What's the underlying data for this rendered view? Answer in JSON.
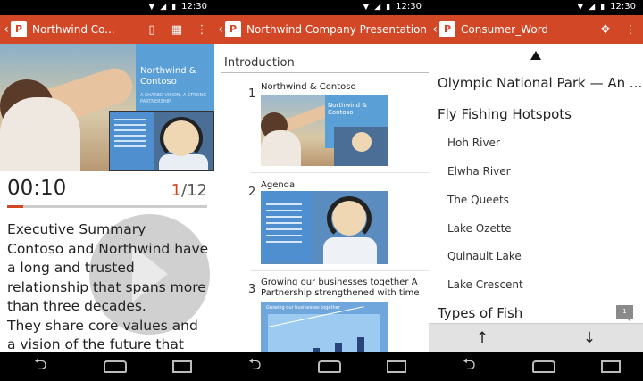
{
  "status": {
    "time": "12:30",
    "wifi_icon": "wifi-icon",
    "signal_icon": "signal-icon",
    "battery_icon": "battery-icon"
  },
  "colors": {
    "accent": "#d24726",
    "navbar": "#000000",
    "toolbar": "#e2e2e2"
  },
  "presenter": {
    "title": "Northwind Co...",
    "timer": "00:10",
    "current_slide": "1",
    "total_slides": "/12",
    "progress": 0.08,
    "slide_title": "Northwind & Contoso",
    "slide_subtitle": "A SHARED VISION, A STRONG PARTNERSHIP",
    "notes": [
      "Executive Summary",
      "Contoso and Northwind have a long and trusted relationship that spans more than three decades.",
      "They share core values and a vision of the future that has"
    ]
  },
  "outline": {
    "title": "Northwind Company Presentation",
    "section": "Introduction",
    "slides": [
      {
        "num": "1",
        "title": "Northwind & Contoso",
        "thumb_text": "Northwind & Contoso"
      },
      {
        "num": "2",
        "title": "Agenda"
      },
      {
        "num": "3",
        "title": "Growing our businesses together A Partnership strengthened with time",
        "thumb_text": "Growing our businesses together"
      }
    ]
  },
  "word": {
    "title": "Consumer_Word",
    "heading1": "Olympic National Park — An ...",
    "heading2": "Fly Fishing Hotspots",
    "items": [
      "Hoh River",
      "Elwha River",
      "The Queets",
      "Lake Ozette",
      "Quinault Lake",
      "Lake Crescent"
    ],
    "heading3": "Types of Fish",
    "comment_count": "1"
  }
}
